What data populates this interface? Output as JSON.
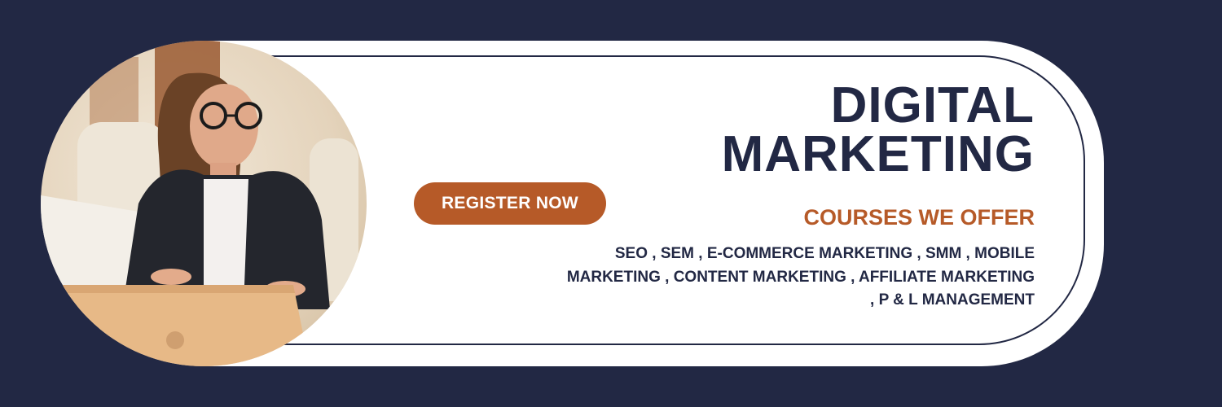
{
  "banner": {
    "title_line1": "DIGITAL",
    "title_line2": "MARKETING",
    "register_label": "REGISTER NOW",
    "subtitle": "COURSES WE OFFER",
    "courses_text": "SEO , SEM , E-COMMERCE MARKETING , SMM , MOBILE MARKETING , CONTENT MARKETING , AFFILIATE MARKETING , P & L MANAGEMENT",
    "photo_icon": "woman-with-laptop-photo",
    "colors": {
      "navy": "#222844",
      "accent": "#b65a28",
      "card": "#ffffff"
    }
  }
}
